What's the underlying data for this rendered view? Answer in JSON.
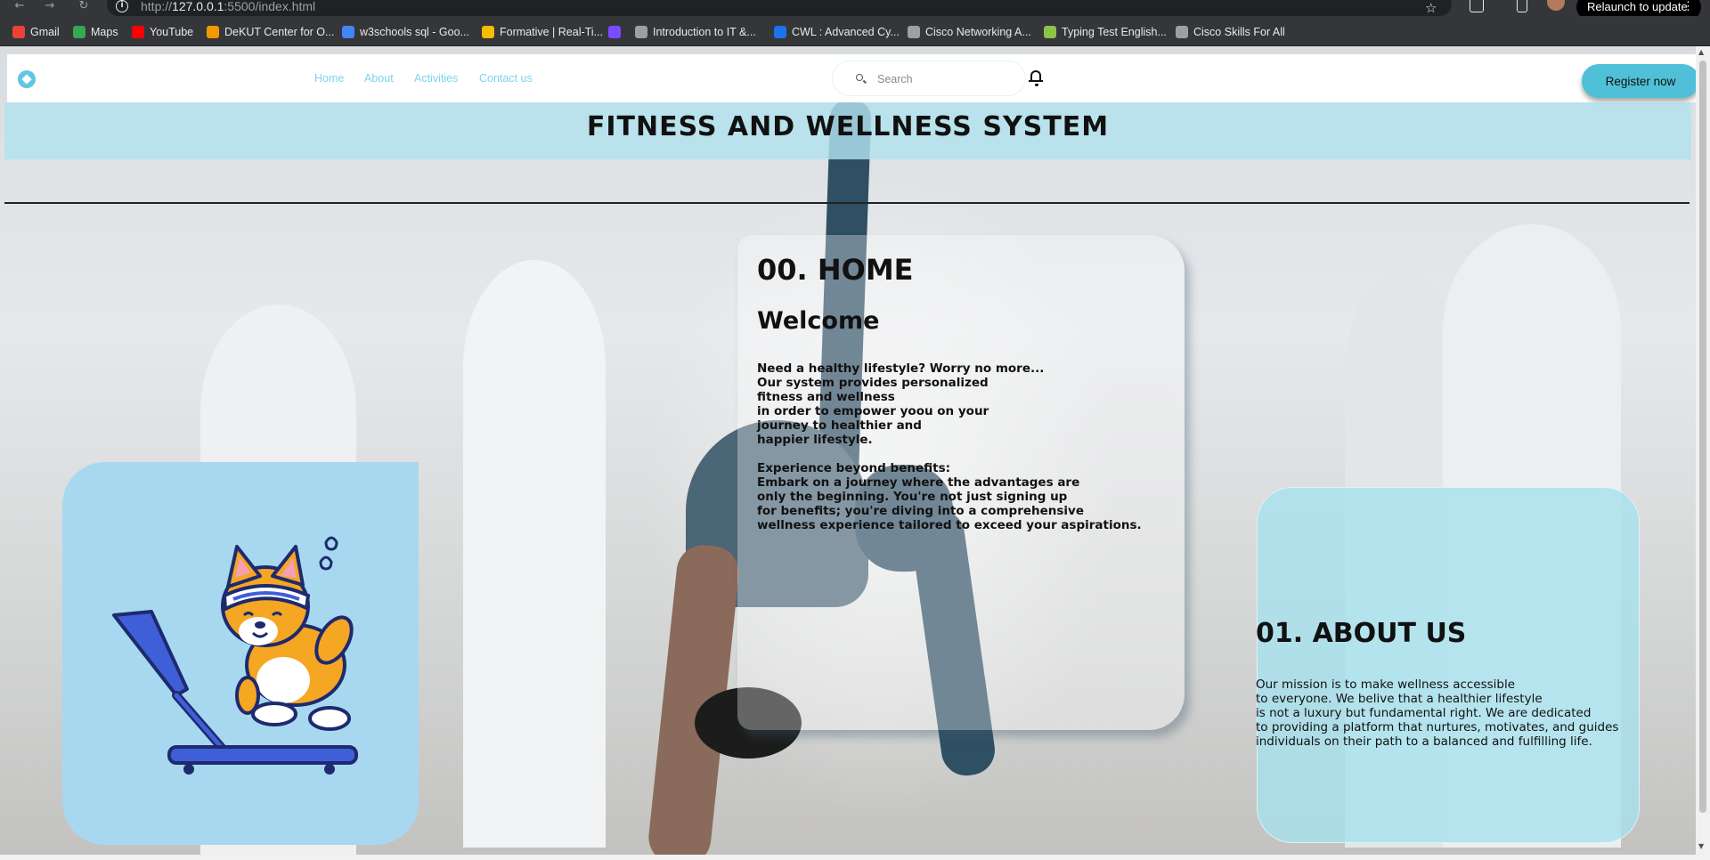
{
  "browser": {
    "url_prefix": "http://",
    "url_host": "127.0.0.1",
    "url_rest": ":5500/index.html",
    "relaunch_label": "Relaunch to update",
    "bookmarks": [
      {
        "label": "Gmail",
        "icon": "gmail-icon",
        "color": "#ea4335"
      },
      {
        "label": "Maps",
        "icon": "maps-icon",
        "color": "#34a853"
      },
      {
        "label": "YouTube",
        "icon": "youtube-icon",
        "color": "#ff0000"
      },
      {
        "label": "DeKUT Center for O...",
        "icon": "dekut-icon",
        "color": "#f29900"
      },
      {
        "label": "w3schools sql - Goo...",
        "icon": "google-icon",
        "color": "#4285f4"
      },
      {
        "label": "Formative | Real-Ti...",
        "icon": "formative-icon",
        "color": "#fbbc04"
      },
      {
        "label": "",
        "icon": "app-icon",
        "color": "#7b4bff"
      },
      {
        "label": "Introduction to IT &...",
        "icon": "course-icon",
        "color": "#9aa0a6"
      },
      {
        "label": "CWL : Advanced Cy...",
        "icon": "cwl-icon",
        "color": "#1a73e8"
      },
      {
        "label": "Cisco Networking A...",
        "icon": "cisco-icon",
        "color": "#9aa0a6"
      },
      {
        "label": "Typing Test English...",
        "icon": "typing-icon",
        "color": "#8bc34a"
      },
      {
        "label": "Cisco Skills For All",
        "icon": "cisco-skills-icon",
        "color": "#9aa0a6"
      }
    ]
  },
  "nav": {
    "links": [
      "Home",
      "About",
      "Activities",
      "Contact us"
    ],
    "search_placeholder": "Search",
    "register_label": "Register now"
  },
  "site_title": "FITNESS AND WELLNESS SYSTEM",
  "home": {
    "heading": "00. HOME",
    "welcome": "Welcome",
    "paragraph1": [
      "Need a healthy lifestyle? Worry no more...",
      "Our system provides personalized",
      "fitness and wellness",
      "in order to empower yoou on your",
      "journey to healthier and",
      "happier lifestyle."
    ],
    "paragraph2": [
      "Experience beyond benefits:",
      "Embark on a journey where the advantages are",
      "only the beginning. You're not just signing up",
      "for benefits; you're diving into a comprehensive",
      "wellness experience tailored to exceed your aspirations."
    ]
  },
  "about": {
    "heading": "01. ABOUT US",
    "lines": [
      "Our mission is to make wellness accessible",
      "to everyone. We belive that a healthier lifestyle",
      "is not a luxury but fundamental right. We are dedicated",
      "to providing a platform that nurtures, motivates, and guides",
      "individuals on their path to a balanced and fulfilling life."
    ]
  },
  "colors": {
    "accent": "#4fc0d8",
    "nav_link": "#7dd4ea",
    "title_band": "#b2e2ee",
    "corgi_card": "#a8d8f0",
    "about_card": "#a5e1ee"
  }
}
